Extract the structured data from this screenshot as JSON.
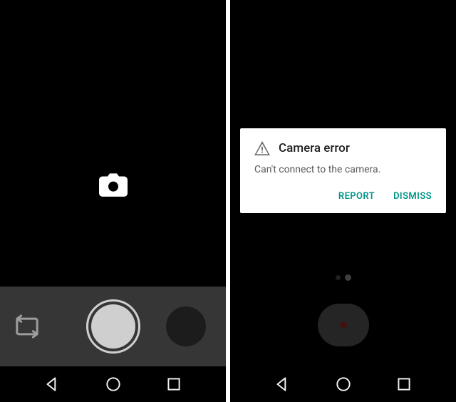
{
  "dialog": {
    "title": "Camera error",
    "body": "Can't connect to the camera.",
    "report_label": "REPORT",
    "dismiss_label": "DISMISS"
  },
  "icons": {
    "camera": "camera-icon",
    "mode_switch": "switch-camera-icon",
    "warning": "warning-icon",
    "nav_back": "back-icon",
    "nav_home": "home-icon",
    "nav_recent": "recent-apps-icon"
  },
  "colors": {
    "accent": "#009688",
    "dialog_bg": "#ffffff",
    "dialog_text": "#212121",
    "shutter": "#cfcfcf"
  }
}
